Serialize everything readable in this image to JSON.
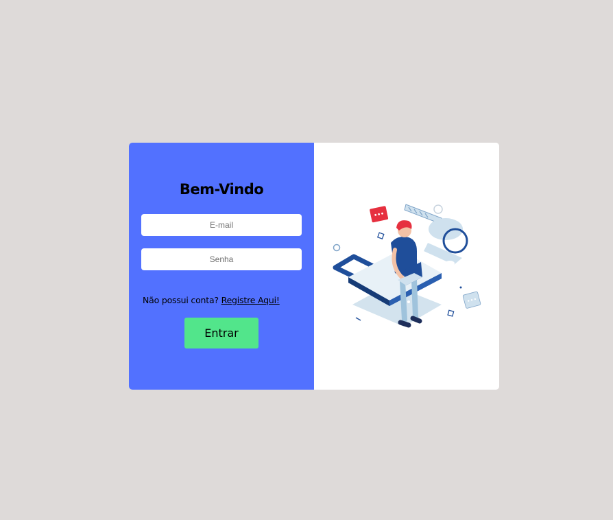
{
  "login": {
    "title": "Bem-Vindo",
    "email_placeholder": "E-mail",
    "password_placeholder": "Senha",
    "register_prompt": "Não possui conta?",
    "register_link": "Registre Aqui!",
    "submit_label": "Entrar"
  },
  "illustration": {
    "icon": "person-with-laptop-and-key-illustration"
  },
  "colors": {
    "page_background": "#dedad9",
    "form_panel": "#5271ff",
    "submit_button": "#52e58b",
    "illustration_primary": "#1f4e9a",
    "illustration_light": "#cfe1ee",
    "accent_red": "#e6303f"
  }
}
